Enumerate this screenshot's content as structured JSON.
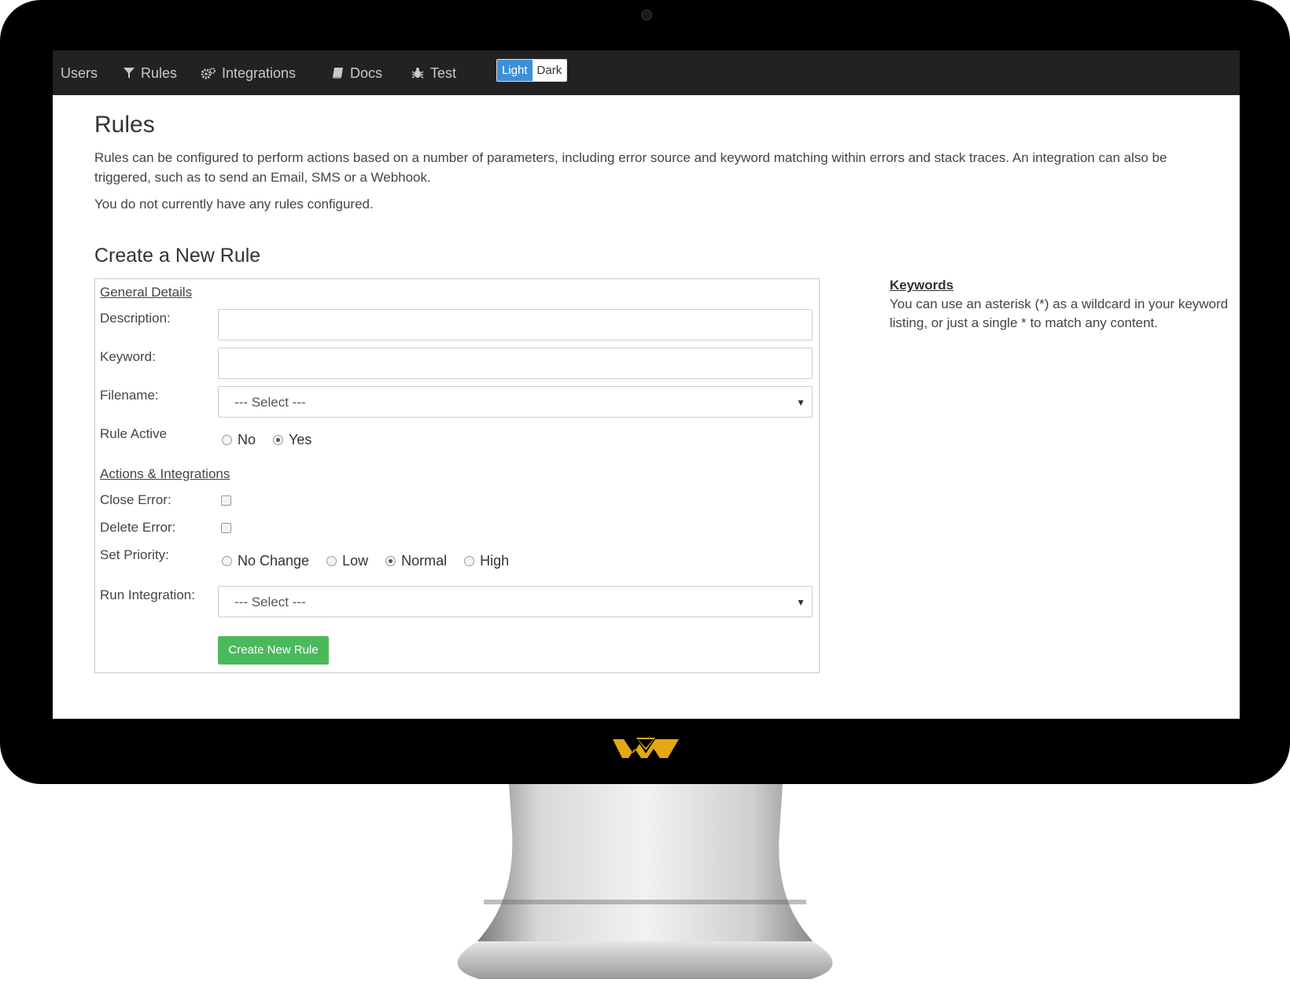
{
  "navbar": {
    "items": [
      {
        "label": "Users",
        "icon": "users-icon"
      },
      {
        "label": "Rules",
        "icon": "filter-icon"
      },
      {
        "label": "Integrations",
        "icon": "cogs-icon"
      },
      {
        "label": "Docs",
        "icon": "book-icon"
      },
      {
        "label": "Test",
        "icon": "bug-icon"
      }
    ],
    "theme": {
      "light": "Light",
      "dark": "Dark",
      "selected": "Light"
    }
  },
  "page": {
    "title": "Rules",
    "intro": "Rules can be configured to perform actions based on a number of parameters, including error source and keyword matching within errors and stack traces. An integration can also be triggered, such as to send an Email, SMS or a Webhook.",
    "no_rules": "You do not currently have any rules configured."
  },
  "form": {
    "title": "Create a New Rule",
    "general_legend": "General Details",
    "description_label": "Description:",
    "description_value": "",
    "keyword_label": "Keyword:",
    "keyword_value": "",
    "filename_label": "Filename:",
    "filename_selected": "--- Select ---",
    "rule_active_label": "Rule Active",
    "rule_active_options": [
      "No",
      "Yes"
    ],
    "rule_active_selected": "Yes",
    "actions_legend": "Actions & Integrations",
    "close_error_label": "Close Error:",
    "delete_error_label": "Delete Error:",
    "priority_label": "Set Priority:",
    "priority_options": [
      "No Change",
      "Low",
      "Normal",
      "High"
    ],
    "priority_selected": "Normal",
    "run_integration_label": "Run Integration:",
    "run_integration_selected": "--- Select ---",
    "submit_label": "Create New Rule"
  },
  "sidebar": {
    "title": "Keywords",
    "text": "You can use an asterisk (*) as a wildcard in your keyword listing, or just a single * to match any content."
  },
  "colors": {
    "navbar_bg": "#222222",
    "theme_active": "#3e8fd6",
    "button_green": "#4cb85c",
    "logo_gold": "#e5a812"
  }
}
